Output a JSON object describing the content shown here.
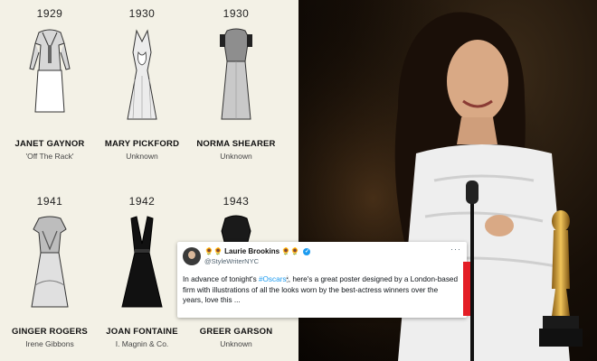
{
  "poster": {
    "background": "#f3f1e6",
    "dresses": [
      {
        "year": "1929",
        "name": "JANET GAYNOR",
        "designer": "'Off The Rack'",
        "icon": "dress-icon"
      },
      {
        "year": "1930",
        "name": "MARY PICKFORD",
        "designer": "Unknown",
        "icon": "dress-icon"
      },
      {
        "year": "1930",
        "name": "NORMA SHEARER",
        "designer": "Unknown",
        "icon": "dress-icon"
      },
      {
        "year": "1941",
        "name": "GINGER ROGERS",
        "designer": "Irene Gibbons",
        "icon": "dress-icon"
      },
      {
        "year": "1942",
        "name": "JOAN FONTAINE",
        "designer": "I. Magnin & Co.",
        "icon": "dress-icon"
      },
      {
        "year": "1943",
        "name": "GREER GARSON",
        "designer": "Unknown",
        "icon": "dress-icon"
      }
    ]
  },
  "tweet": {
    "author_prefix": "🌻🌻",
    "author": "Laurie Brookins",
    "author_suffix": "🌻🌻",
    "handle": "@StyleWriterNYC",
    "more": "···",
    "body_1": "In advance of tonight's ",
    "hashtag": "#Oscars",
    "body_emoji": "🕯",
    "body_2": ", here's a great poster designed by a London-based firm with illustrations of all the looks worn by the best-actress winners over the years, love this ...",
    "accent_color": "#e41e26",
    "link_color": "#1d9bf0"
  }
}
